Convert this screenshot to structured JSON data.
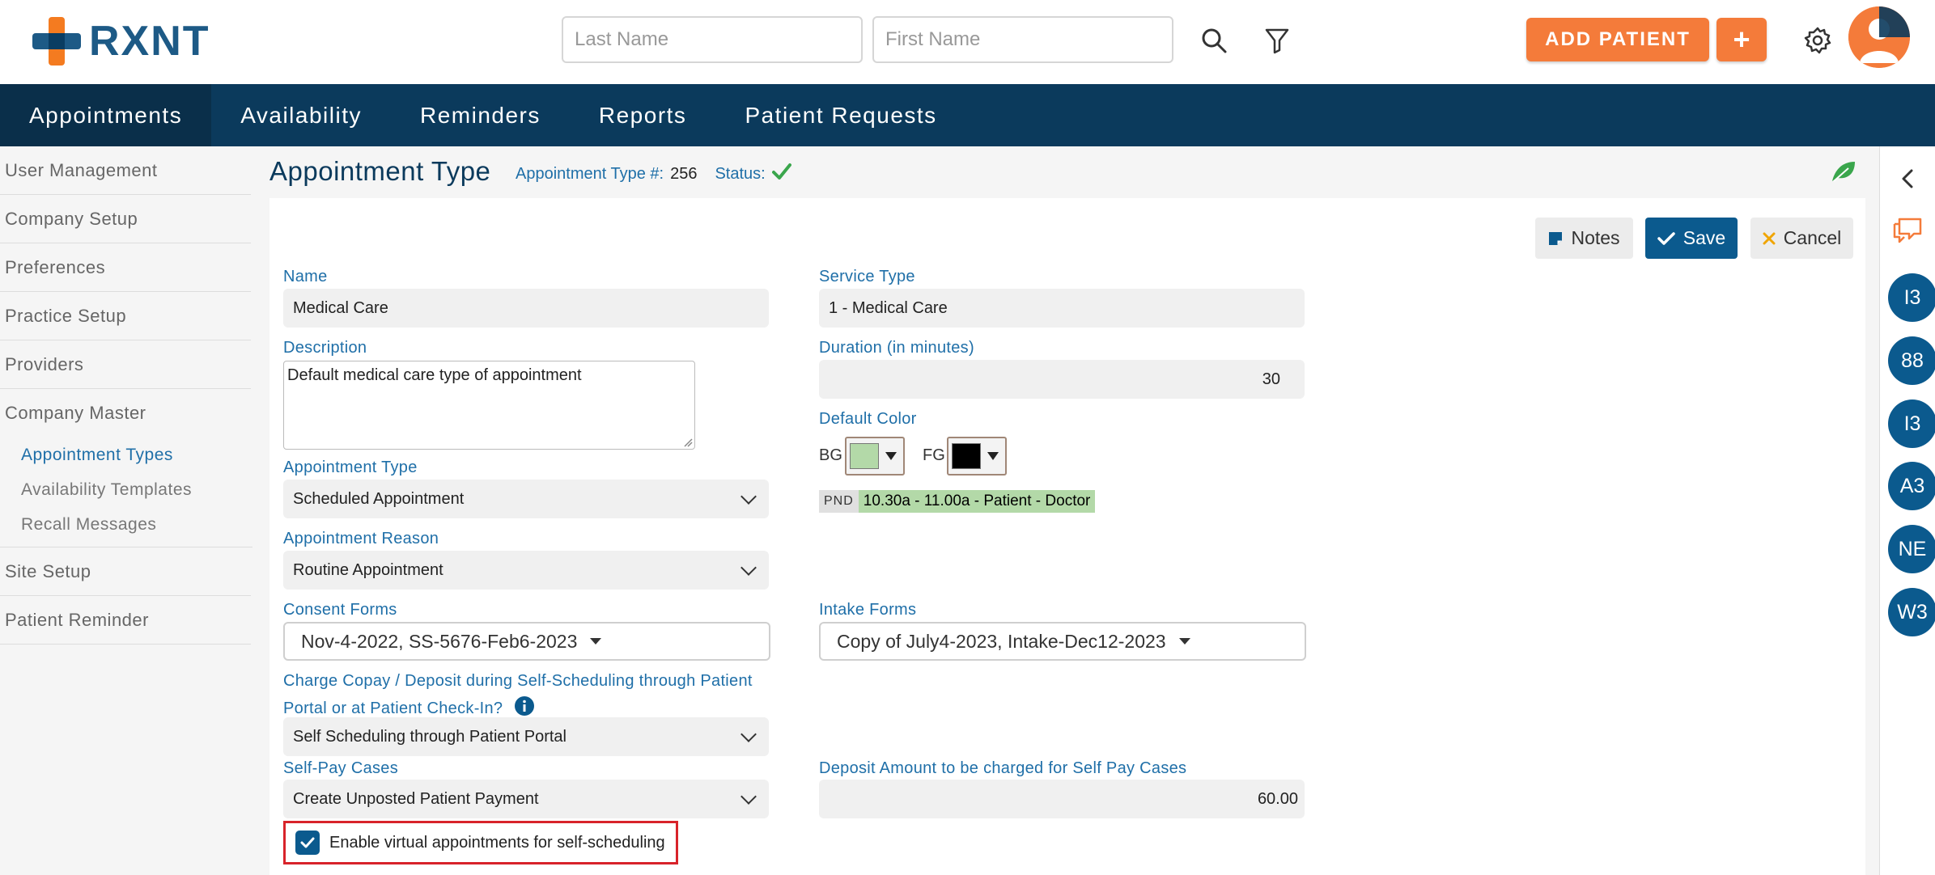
{
  "header": {
    "logo_text": "RXNT",
    "last_name_placeholder": "Last Name",
    "first_name_placeholder": "First Name",
    "add_patient_label": "ADD PATIENT",
    "add_plus_label": "+"
  },
  "nav": {
    "items": [
      "Appointments",
      "Availability",
      "Reminders",
      "Reports",
      "Patient Requests"
    ],
    "active": "Appointments"
  },
  "sidebar": {
    "items": [
      "User Management",
      "Company Setup",
      "Preferences",
      "Practice Setup",
      "Providers"
    ],
    "group": {
      "label": "Company Master",
      "subitems": [
        "Appointment Types",
        "Availability Templates",
        "Recall Messages"
      ],
      "active": "Appointment Types"
    },
    "after": [
      "Site Setup",
      "Patient Reminder"
    ]
  },
  "page": {
    "title": "Appointment Type",
    "type_num_label": "Appointment Type #:",
    "type_num_value": "256",
    "status_label": "Status:"
  },
  "actions": {
    "notes": "Notes",
    "save": "Save",
    "cancel": "Cancel"
  },
  "form": {
    "name_label": "Name",
    "name_value": "Medical Care",
    "service_type_label": "Service Type",
    "service_type_value": "1 - Medical Care",
    "description_label": "Description",
    "description_value": "Default medical care type of appointment",
    "duration_label": "Duration (in minutes)",
    "duration_value": "30",
    "default_color_label": "Default Color",
    "bg_label": "BG",
    "fg_label": "FG",
    "bg_color": "#b3d9a8",
    "fg_color": "#000000",
    "preview_tag": "PND",
    "preview_text": "10.30a - 11.00a - Patient - Doctor",
    "appt_type_label": "Appointment Type",
    "appt_type_value": "Scheduled Appointment",
    "appt_reason_label": "Appointment Reason",
    "appt_reason_value": "Routine Appointment",
    "consent_label": "Consent Forms",
    "consent_value": "Nov-4-2022,  SS-5676-Feb6-2023",
    "intake_label": "Intake Forms",
    "intake_value": "Copy of July4-2023,  Intake-Dec12-2023",
    "copay_label_1": "Charge Copay / Deposit during Self-Scheduling through Patient",
    "copay_label_2": "Portal or at Patient Check-In?",
    "copay_value": "Self Scheduling through Patient Portal",
    "selfpay_label": "Self-Pay Cases",
    "selfpay_value": "Create Unposted Patient Payment",
    "deposit_label": "Deposit Amount to be charged for Self Pay Cases",
    "deposit_value": "60.00",
    "virtual_label": "Enable virtual appointments for self-scheduling",
    "virtual_checked": true
  },
  "rail": {
    "badges": [
      "I3",
      "88",
      "I3",
      "A3",
      "NE",
      "W3"
    ]
  },
  "colors": {
    "brand_orange": "#f47b3a",
    "brand_navy": "#0b3a5c",
    "accent_blue": "#1f6fa8",
    "status_green": "#3aa64c",
    "highlight_red": "#d8232a"
  }
}
